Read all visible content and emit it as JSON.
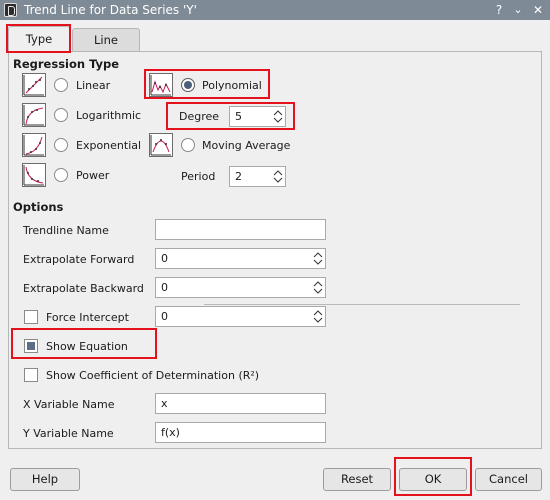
{
  "window": {
    "title": "Trend Line for Data Series 'Y'",
    "help_glyph": "?",
    "minimize_glyph": "⌄",
    "close_glyph": "✕"
  },
  "tabs": [
    {
      "label": "Type",
      "active": true
    },
    {
      "label": "Line",
      "active": false
    }
  ],
  "regression": {
    "heading": "Regression Type",
    "linear": {
      "label": "Linear",
      "selected": false,
      "icon": "linear-graph-icon"
    },
    "logarithmic": {
      "label": "Logarithmic",
      "selected": false,
      "icon": "logarithmic-graph-icon"
    },
    "exponential": {
      "label": "Exponential",
      "selected": false,
      "icon": "exponential-graph-icon"
    },
    "power": {
      "label": "Power",
      "selected": false,
      "icon": "power-graph-icon"
    },
    "polynomial": {
      "label": "Polynomial",
      "selected": true,
      "icon": "polynomial-graph-icon"
    },
    "moving_average": {
      "label": "Moving Average",
      "selected": false,
      "icon": "moving-average-graph-icon"
    },
    "degree": {
      "label": "Degree",
      "value": "5"
    },
    "period": {
      "label": "Period",
      "value": "2"
    }
  },
  "options": {
    "heading": "Options",
    "trendline_name": {
      "label": "Trendline Name",
      "value": ""
    },
    "extrapolate_forward": {
      "label": "Extrapolate Forward",
      "value": "0"
    },
    "extrapolate_backward": {
      "label": "Extrapolate Backward",
      "value": "0"
    },
    "force_intercept": {
      "label": "Force Intercept",
      "checked": false,
      "value": "0"
    },
    "show_equation": {
      "label": "Show Equation",
      "checked": true
    },
    "show_r2": {
      "label": "Show Coefficient of Determination (R²)",
      "checked": false
    },
    "x_variable": {
      "label": "X Variable Name",
      "value": "x"
    },
    "y_variable": {
      "label": "Y Variable Name",
      "value": "f(x)"
    }
  },
  "buttons": {
    "help": "Help",
    "reset": "Reset",
    "ok": "OK",
    "cancel": "Cancel"
  },
  "colors": {
    "highlight": "#e4121c",
    "titlebar": "#7f8a97",
    "curve": "#c2185b"
  }
}
